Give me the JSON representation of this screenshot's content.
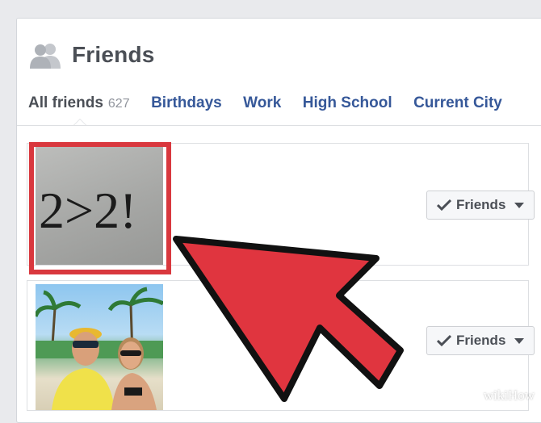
{
  "header": {
    "title": "Friends"
  },
  "tabs": [
    {
      "label": "All friends",
      "count": "627",
      "active": true
    },
    {
      "label": "Birthdays"
    },
    {
      "label": "Work"
    },
    {
      "label": "High School"
    },
    {
      "label": "Current City"
    }
  ],
  "friends": [
    {
      "photo_text": "2>2!",
      "button_label": "Friends",
      "highlighted": true
    },
    {
      "photo_desc": "couple-selfie",
      "button_label": "Friends"
    }
  ],
  "icons": {
    "header": "friends-icon",
    "button_check": "checkmark-icon",
    "button_caret": "caret-down-icon",
    "annotation": "arrow-pointer-icon"
  },
  "colors": {
    "link": "#365899",
    "title": "#4b4f56",
    "highlight": "#d9383e",
    "arrow_fill": "#e0353f"
  },
  "watermark": "wikiHow"
}
